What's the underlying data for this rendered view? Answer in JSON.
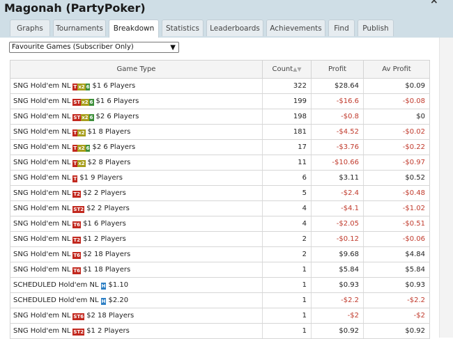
{
  "window": {
    "title": "Magonah (PartyPoker)",
    "close_glyph": "×"
  },
  "tabs": [
    {
      "label": "Graphs",
      "active": false
    },
    {
      "label": "Tournaments",
      "active": false
    },
    {
      "label": "Breakdown",
      "active": true
    },
    {
      "label": "Statistics",
      "active": false
    },
    {
      "label": "Leaderboards",
      "active": false
    },
    {
      "label": "Achievements",
      "active": false
    },
    {
      "label": "Find",
      "active": false
    },
    {
      "label": "Publish",
      "active": false
    }
  ],
  "filter": {
    "selected": "Favourite Games (Subscriber Only)"
  },
  "table": {
    "headers": {
      "game_type": "Game Type",
      "count": "Count",
      "profit": "Profit",
      "av_profit": "Av Profit"
    },
    "rows": [
      {
        "prefix": "SNG Hold'em NL",
        "badge": [
          "T",
          "x2",
          "6"
        ],
        "suffix": "$1 6 Players",
        "count": "322",
        "profit": "$28.64",
        "av_profit": "$0.09"
      },
      {
        "prefix": "SNG Hold'em NL",
        "badge": [
          "ST",
          "x2",
          "6"
        ],
        "suffix": "$1 6 Players",
        "count": "199",
        "profit": "-$16.6",
        "av_profit": "-$0.08"
      },
      {
        "prefix": "SNG Hold'em NL",
        "badge": [
          "ST",
          "x2",
          "6"
        ],
        "suffix": "$2 6 Players",
        "count": "198",
        "profit": "-$0.8",
        "av_profit": "$0"
      },
      {
        "prefix": "SNG Hold'em NL",
        "badge": [
          "T",
          "x2"
        ],
        "suffix": "$1 8 Players",
        "count": "181",
        "profit": "-$4.52",
        "av_profit": "-$0.02"
      },
      {
        "prefix": "SNG Hold'em NL",
        "badge": [
          "T",
          "x2",
          "6"
        ],
        "suffix": "$2 6 Players",
        "count": "17",
        "profit": "-$3.76",
        "av_profit": "-$0.22"
      },
      {
        "prefix": "SNG Hold'em NL",
        "badge": [
          "T",
          "x2"
        ],
        "suffix": "$2 8 Players",
        "count": "11",
        "profit": "-$10.66",
        "av_profit": "-$0.97"
      },
      {
        "prefix": "SNG Hold'em NL",
        "badge": [
          "T"
        ],
        "suffix": "$1 9 Players",
        "count": "6",
        "profit": "$3.11",
        "av_profit": "$0.52"
      },
      {
        "prefix": "SNG Hold'em NL",
        "badge": [
          "T2"
        ],
        "suffix": "$2 2 Players",
        "count": "5",
        "profit": "-$2.4",
        "av_profit": "-$0.48"
      },
      {
        "prefix": "SNG Hold'em NL",
        "badge": [
          "ST2"
        ],
        "suffix": "$2 2 Players",
        "count": "4",
        "profit": "-$4.1",
        "av_profit": "-$1.02"
      },
      {
        "prefix": "SNG Hold'em NL",
        "badge": [
          "T6"
        ],
        "suffix": "$1 6 Players",
        "count": "4",
        "profit": "-$2.05",
        "av_profit": "-$0.51"
      },
      {
        "prefix": "SNG Hold'em NL",
        "badge": [
          "T2"
        ],
        "suffix": "$1 2 Players",
        "count": "2",
        "profit": "-$0.12",
        "av_profit": "-$0.06"
      },
      {
        "prefix": "SNG Hold'em NL",
        "badge": [
          "T6"
        ],
        "suffix": "$2 18 Players",
        "count": "2",
        "profit": "$9.68",
        "av_profit": "$4.84"
      },
      {
        "prefix": "SNG Hold'em NL",
        "badge": [
          "T6"
        ],
        "suffix": "$1 18 Players",
        "count": "1",
        "profit": "$5.84",
        "av_profit": "$5.84"
      },
      {
        "prefix": "SCHEDULED Hold'em NL",
        "badge": [
          "H"
        ],
        "suffix": "$1.10",
        "count": "1",
        "profit": "$0.93",
        "av_profit": "$0.93"
      },
      {
        "prefix": "SCHEDULED Hold'em NL",
        "badge": [
          "H"
        ],
        "suffix": "$2.20",
        "count": "1",
        "profit": "-$2.2",
        "av_profit": "-$2.2"
      },
      {
        "prefix": "SNG Hold'em NL",
        "badge": [
          "ST6"
        ],
        "suffix": "$2 18 Players",
        "count": "1",
        "profit": "-$2",
        "av_profit": "-$2"
      },
      {
        "prefix": "SNG Hold'em NL",
        "badge": [
          "ST2"
        ],
        "suffix": "$1 2 Players",
        "count": "1",
        "profit": "$0.92",
        "av_profit": "$0.92"
      }
    ]
  }
}
